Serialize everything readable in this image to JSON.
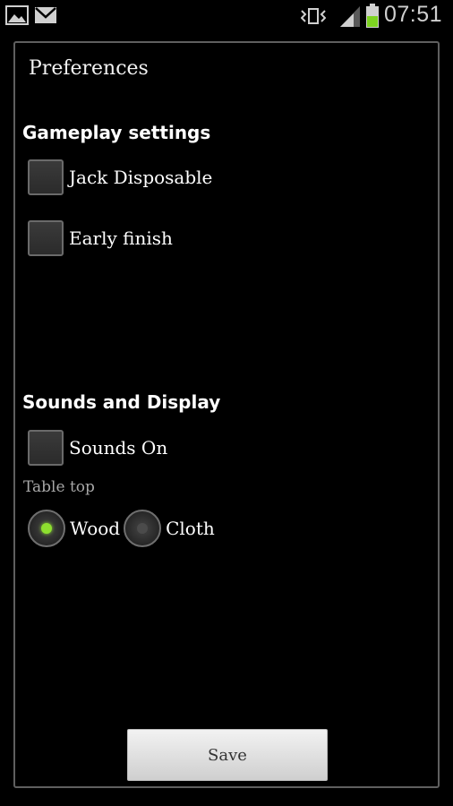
{
  "status_bar": {
    "time": "07:51",
    "icons": [
      "picture-icon",
      "mail-icon",
      "vibrate-icon",
      "signal-icon",
      "battery-icon"
    ],
    "battery_color": "#7dd321"
  },
  "dialog": {
    "title": "Preferences",
    "gameplay_section": {
      "header": "Gameplay settings",
      "options": [
        {
          "label": "Jack Disposable",
          "checked": false
        },
        {
          "label": "Early finish",
          "checked": false
        }
      ]
    },
    "display_section": {
      "header": "Sounds and Display",
      "sounds": {
        "label": "Sounds On",
        "checked": false
      },
      "table_top": {
        "label": "Table top",
        "options": [
          {
            "label": "Wood",
            "selected": true
          },
          {
            "label": "Cloth",
            "selected": false
          }
        ]
      }
    },
    "save_label": "Save"
  },
  "colors": {
    "accent": "#8ee02f",
    "background": "#000000",
    "dialog_border": "#5f5f5f"
  }
}
